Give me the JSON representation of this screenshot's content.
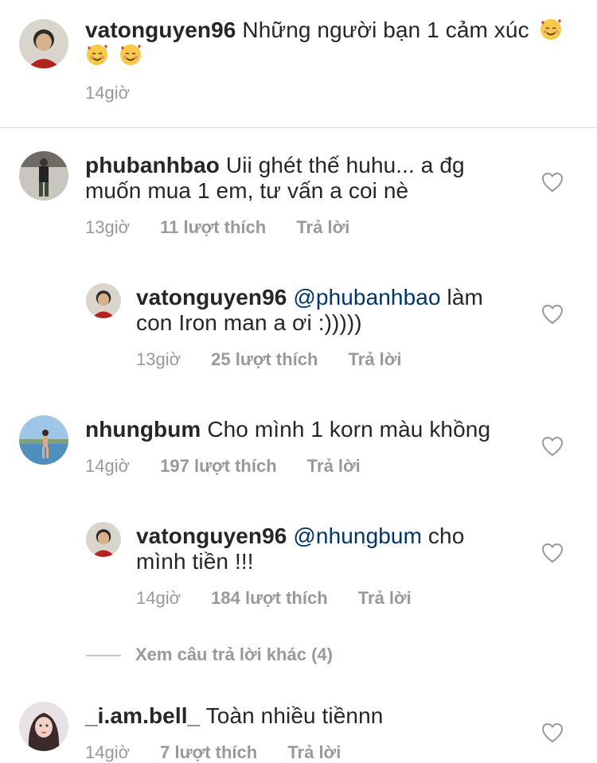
{
  "caption": {
    "username": "vatonguyen96",
    "text": "Những người bạn 1 cảm xúc",
    "emoji": [
      "smiling-face-with-hearts",
      "smiling-face-with-hearts",
      "smiling-face-with-hearts"
    ],
    "time": "14giờ"
  },
  "comments": [
    {
      "username": "phubanhbao",
      "line1": "Uii ghét thế huhu... a đg",
      "line2": "muốn mua 1 em, tư vấn a coi nè",
      "time": "13giờ",
      "likes": "11 lượt thích",
      "reply": "Trả lời"
    },
    {
      "username": "vatonguyen96",
      "mention": "@phubanhbao",
      "line1_rest": "làm",
      "line2": "con Iron man a ơi :)))))",
      "time": "13giờ",
      "likes": "25 lượt thích",
      "reply": "Trả lời"
    },
    {
      "username": "nhungbum",
      "line1": "Cho mình 1 korn màu khồng",
      "time": "14giờ",
      "likes": "197 lượt thích",
      "reply": "Trả lời"
    },
    {
      "username": "vatonguyen96",
      "mention": "@nhungbum",
      "line1_rest": "cho",
      "line2": "mình tiền !!!",
      "time": "14giờ",
      "likes": "184 lượt thích",
      "reply": "Trả lời"
    },
    {
      "username": "_i.am.bell_",
      "line1": "Toàn nhiều tiềnnn",
      "time": "14giờ",
      "likes": "7 lượt thích",
      "reply": "Trả lời"
    }
  ],
  "more_replies": "Xem câu trả lời khác (4)",
  "colors": {
    "text": "#262626",
    "meta": "#999999",
    "mention": "#003569",
    "divider": "#dbdbdb"
  }
}
